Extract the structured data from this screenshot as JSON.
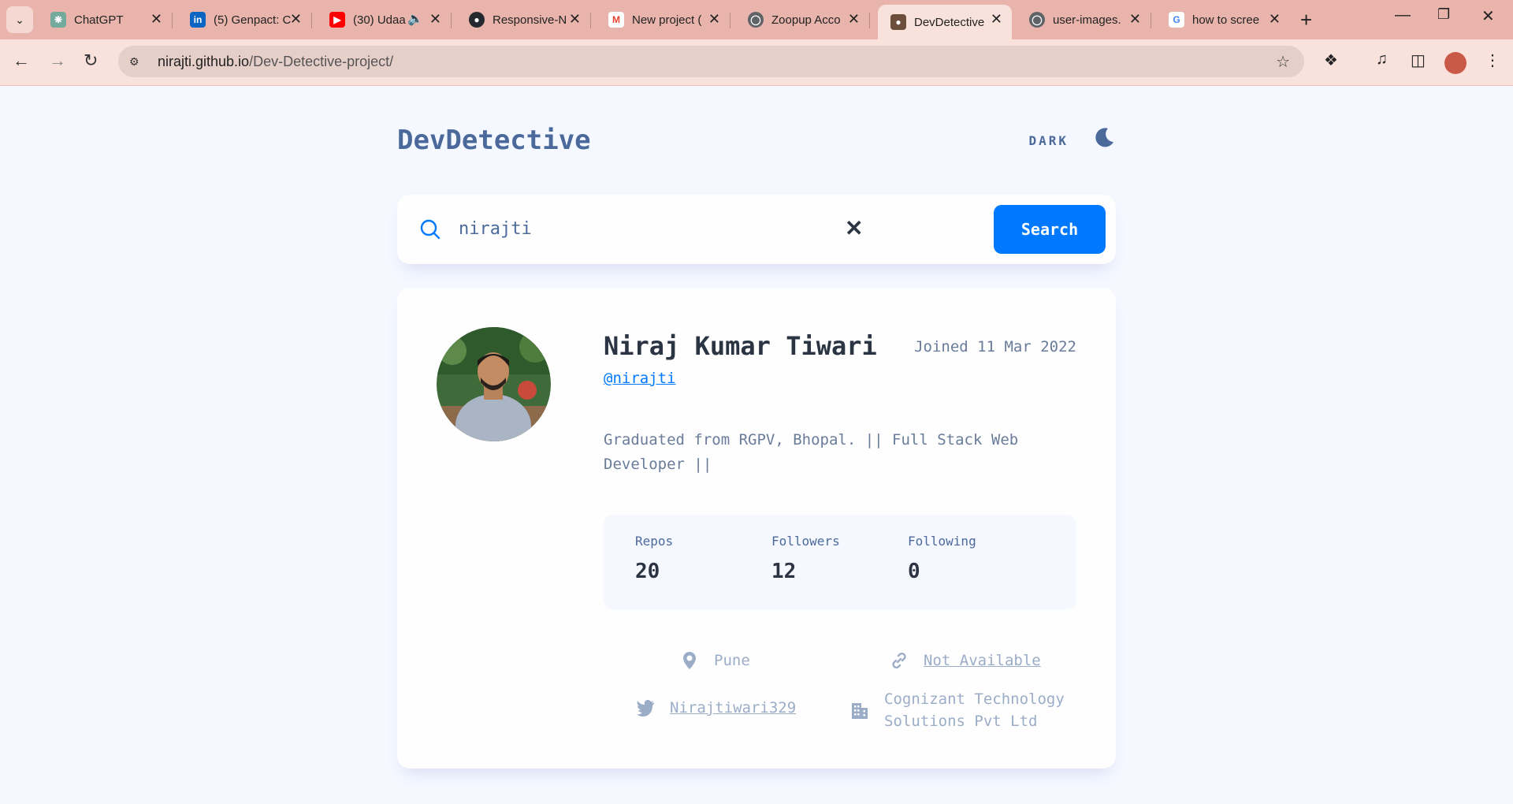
{
  "browser": {
    "tabs": [
      {
        "title": "ChatGPT",
        "icon": "chatgpt-icon"
      },
      {
        "title": "(5) Genpact: C",
        "icon": "linkedin-icon"
      },
      {
        "title": "(30) Udaa",
        "icon": "youtube-icon"
      },
      {
        "title": "Responsive-N",
        "icon": "github-icon"
      },
      {
        "title": "New project (",
        "icon": "gmail-icon"
      },
      {
        "title": "Zoopup Acco",
        "icon": "globe-icon"
      },
      {
        "title": "DevDetective",
        "icon": "spy-icon",
        "active": true
      },
      {
        "title": "user-images.",
        "icon": "globe-icon"
      },
      {
        "title": "how to scree",
        "icon": "google-icon"
      }
    ],
    "url_host": "nirajti.github.io",
    "url_path": "/Dev-Detective-project/"
  },
  "header": {
    "brand": "DevDetective",
    "mode_label": "DARK"
  },
  "search": {
    "value": "nirajti",
    "button_label": "Search"
  },
  "profile": {
    "name": "Niraj Kumar Tiwari",
    "joined": "Joined 11 Mar 2022",
    "handle": "@nirajti",
    "bio": "Graduated from RGPV, Bhopal. || Full Stack Web Developer ||",
    "stats": {
      "repos_label": "Repos",
      "repos": "20",
      "followers_label": "Followers",
      "followers": "12",
      "following_label": "Following",
      "following": "0"
    },
    "location": "Pune",
    "website": "Not Available",
    "twitter": "Nirajtiwari329",
    "company": "Cognizant Technology Solutions Pvt Ltd"
  },
  "colors": {
    "accent": "#0079ff",
    "text_primary": "#2b3442",
    "text_secondary": "#697c9a",
    "brand": "#4b6a9b",
    "page_bg": "#f5f8ff",
    "browser_frame": "#e8b4ab"
  }
}
